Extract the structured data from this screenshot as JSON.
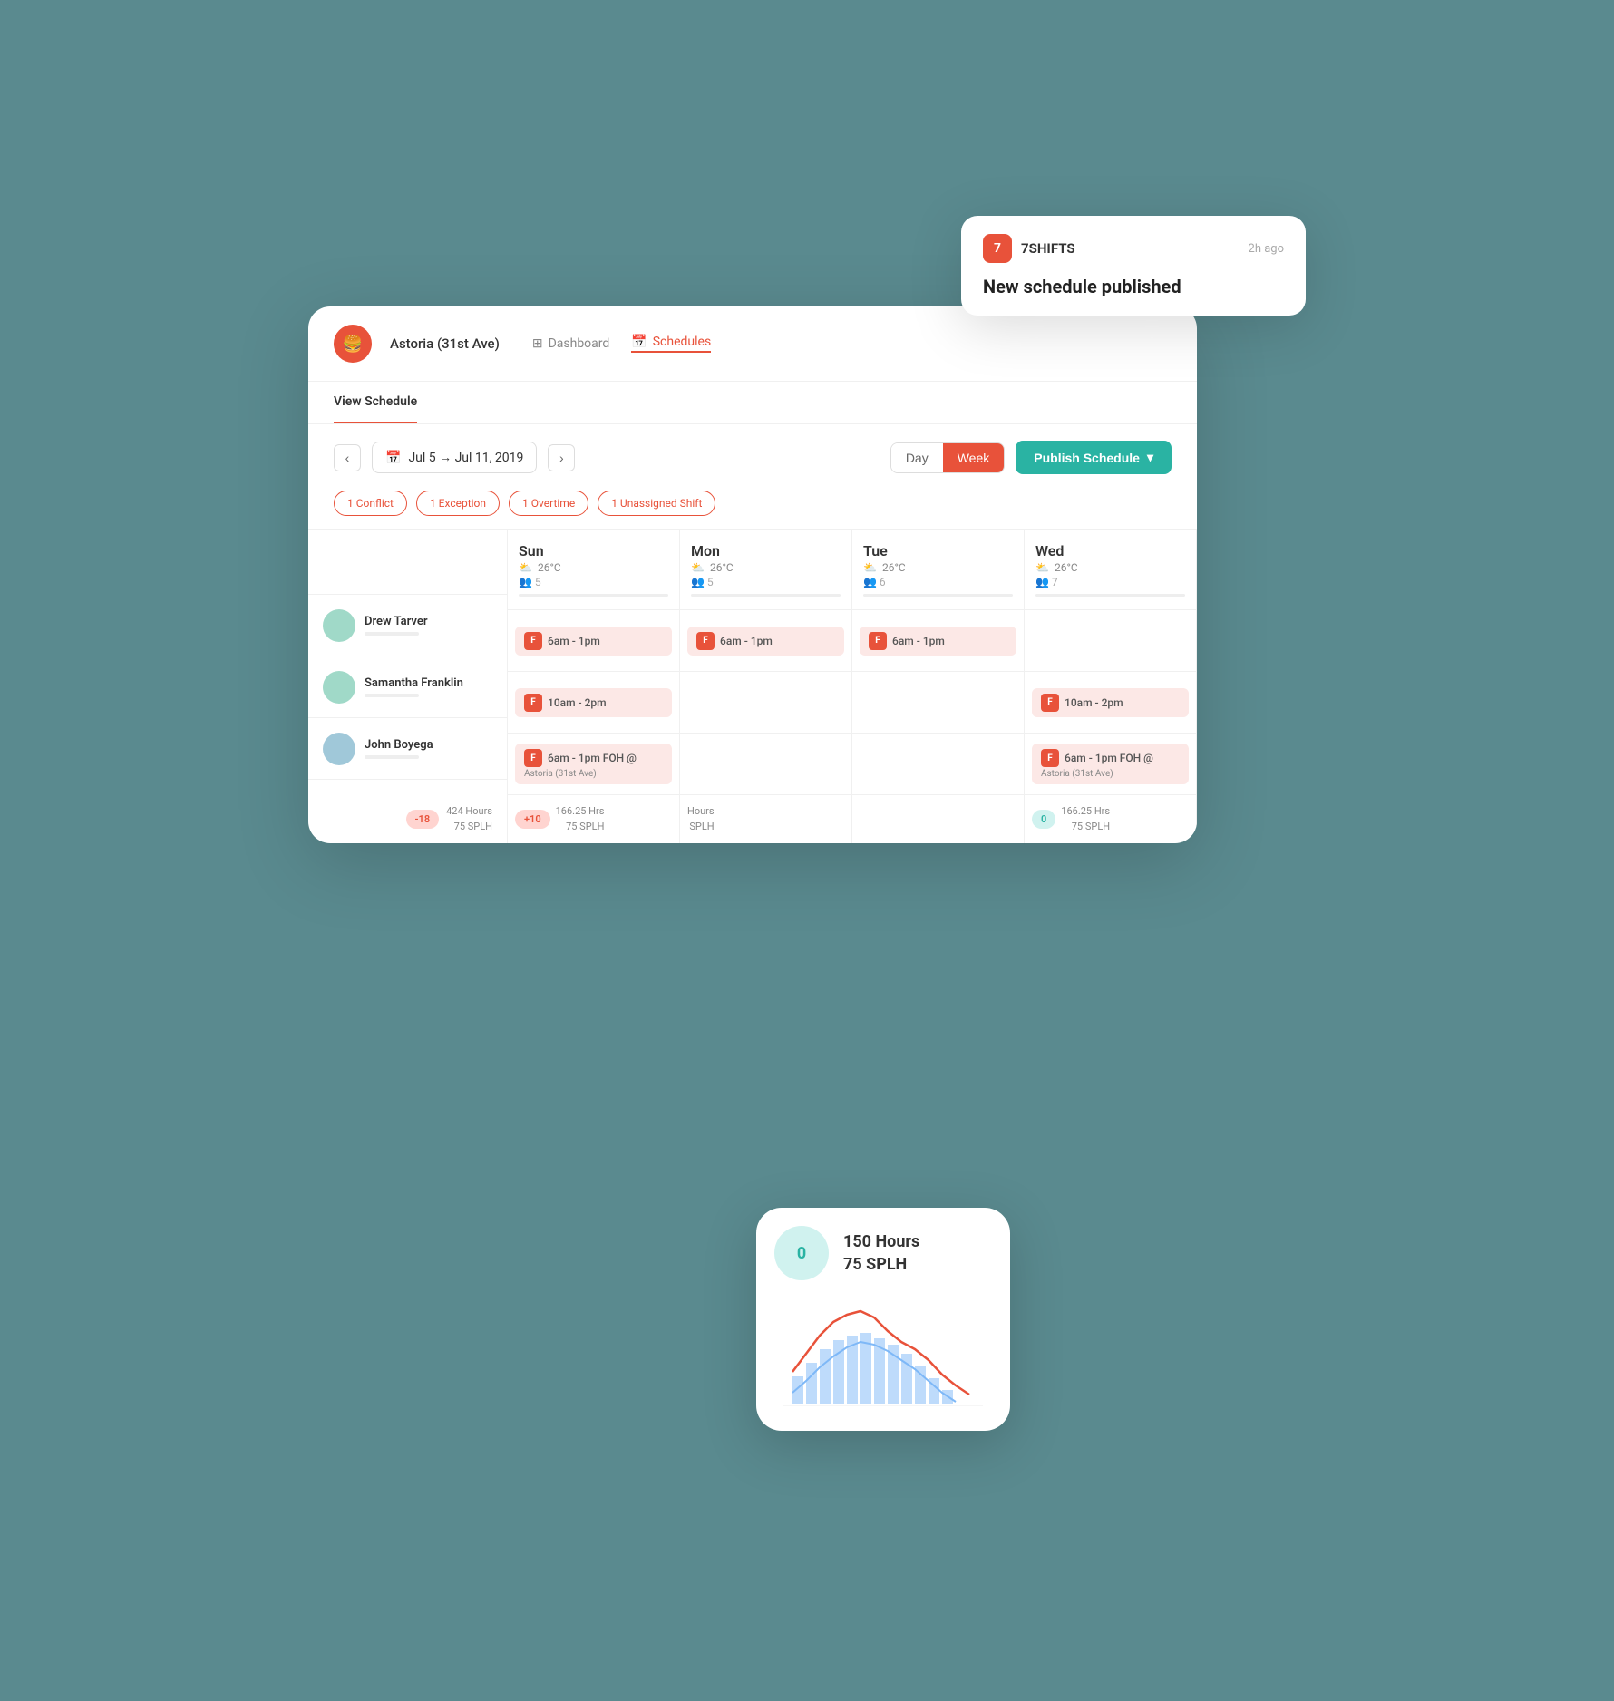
{
  "notification": {
    "brand": "7SHIFTS",
    "time": "2h ago",
    "message": "New schedule published",
    "icon": "7"
  },
  "nav": {
    "location": "Astoria (31st Ave)",
    "items": [
      {
        "label": "Dashboard",
        "active": false
      },
      {
        "label": "Schedules",
        "active": true
      }
    ]
  },
  "tabs": [
    {
      "label": "View Schedule",
      "active": true
    }
  ],
  "dateRange": {
    "label": "Jul 5 → Jul 11, 2019"
  },
  "viewToggle": {
    "day": "Day",
    "week": "Week"
  },
  "publishBtn": "Publish Schedule",
  "filters": [
    "1 Conflict",
    "1 Exception",
    "1 Overtime",
    "1 Unassigned Shift"
  ],
  "days": [
    {
      "name": "Sun",
      "temp": "26°C",
      "staff": "👥 5"
    },
    {
      "name": "Mon",
      "temp": "26°C",
      "staff": "👥 5"
    },
    {
      "name": "Tue",
      "temp": "26°C",
      "staff": "👥 6"
    },
    {
      "name": "Wed",
      "temp": "26°C",
      "staff": "👥 7"
    }
  ],
  "staff": [
    {
      "name": "Drew Tarver",
      "color": "#a0d9c8"
    },
    {
      "name": "Samantha Franklin",
      "color": "#a0d9c8"
    },
    {
      "name": "John Boyega",
      "color": "#a0c8d9"
    }
  ],
  "shifts": {
    "drew": [
      {
        "time": "6am - 1pm",
        "role": "F"
      },
      {
        "time": "6am - 1pm",
        "role": "F"
      },
      {
        "time": "6am - 1pm",
        "role": "F"
      },
      {
        "time": "",
        "role": ""
      }
    ],
    "samantha": [
      {
        "time": "10am - 2pm",
        "role": "F"
      },
      {
        "time": "",
        "role": ""
      },
      {
        "time": "",
        "role": ""
      },
      {
        "time": "10am - 2pm",
        "role": "F"
      }
    ],
    "john": [
      {
        "time": "6am - 1pm FOH @\nAstoria (31st Ave)",
        "role": "F",
        "multiline": true
      },
      {
        "time": "",
        "role": ""
      },
      {
        "time": "",
        "role": ""
      },
      {
        "time": "6am - 1pm FOH @\nAstoria (31st Ave)",
        "role": "F",
        "multiline": true
      }
    ]
  },
  "footer": {
    "col1": {
      "badge": "-18",
      "hours": "424 Hours\n75 SPLH"
    },
    "col2": {
      "badge": "+10",
      "hours": "166.25 Hrs\n75 SPLH"
    },
    "col3": {
      "hours": "Hours\nSPLH"
    },
    "col4": {
      "badge": "0",
      "hours": "166.25 Hrs\n75 SPLH"
    }
  },
  "phone": {
    "stat": "0",
    "hours": "150 Hours",
    "splh": "75 SPLH"
  },
  "colors": {
    "primary": "#e8523a",
    "teal": "#2ab3a3",
    "shiftBg": "#fce8e6",
    "tealBg": "#d0f2ef"
  }
}
